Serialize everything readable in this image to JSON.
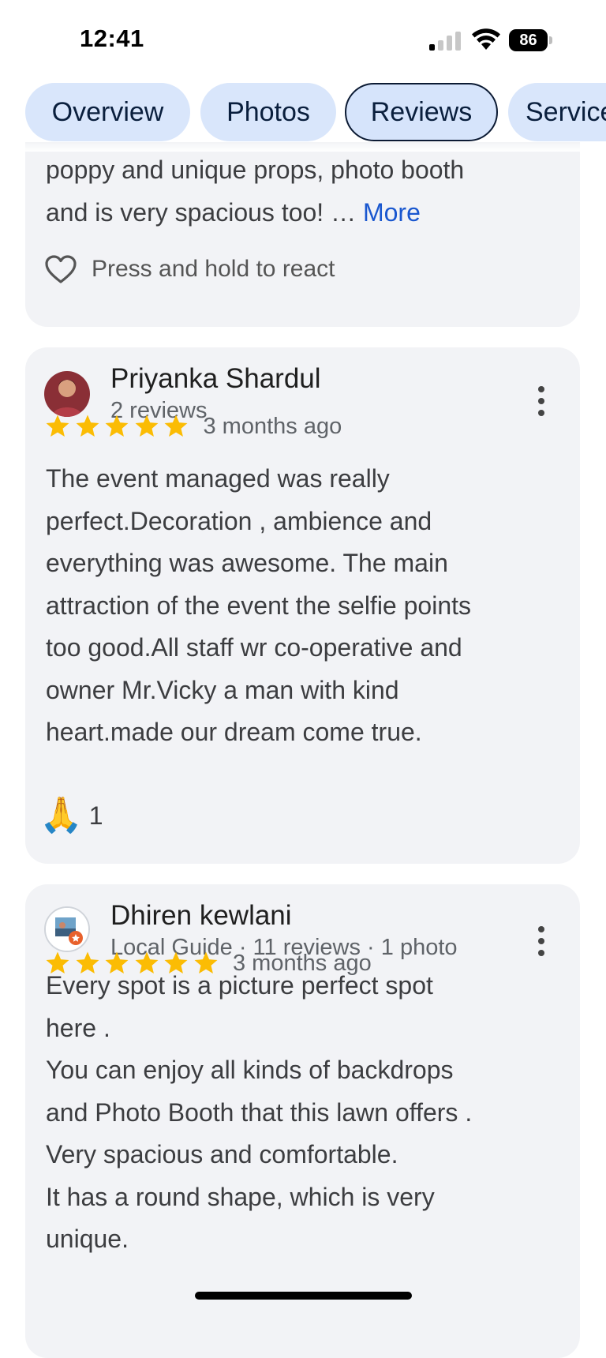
{
  "status_bar": {
    "time": "12:41",
    "battery": "86"
  },
  "tabs": [
    {
      "label": "Overview"
    },
    {
      "label": "Photos"
    },
    {
      "label": "Reviews"
    },
    {
      "label": "Services"
    }
  ],
  "reviews": [
    {
      "text_partial": "poppy and unique props, photo booth\nand is very spacious too! …",
      "more_label": "More",
      "react_label": "Press and hold to react"
    },
    {
      "name": "Priyanka Shardul",
      "meta": "2 reviews",
      "rating": 5,
      "date": "3 months ago",
      "text": "The event managed was really\nperfect.Decoration , ambience and\neverything was awesome. The main\nattraction of the event the selfie points\ntoo good.All staff wr co-operative and\nowner Mr.Vicky a man with kind\nheart.made our dream come true.",
      "reaction_emoji": "🙏",
      "reaction_count": "1"
    },
    {
      "name": "Dhiren kewlani",
      "meta": "Local Guide · 11 reviews · 1 photo",
      "rating": 5,
      "date": "3 months ago",
      "text": "Every spot is a picture perfect spot\nhere .\nYou can enjoy all kinds of backdrops\nand Photo Booth that this lawn offers .\nVery spacious and comfortable.\nIt has a round shape, which is very\nunique."
    }
  ],
  "colors": {
    "star": "#fbbc04",
    "link": "#1a57cf",
    "card_bg": "#f2f3f6",
    "tab_bg": "#d9e6fb"
  }
}
